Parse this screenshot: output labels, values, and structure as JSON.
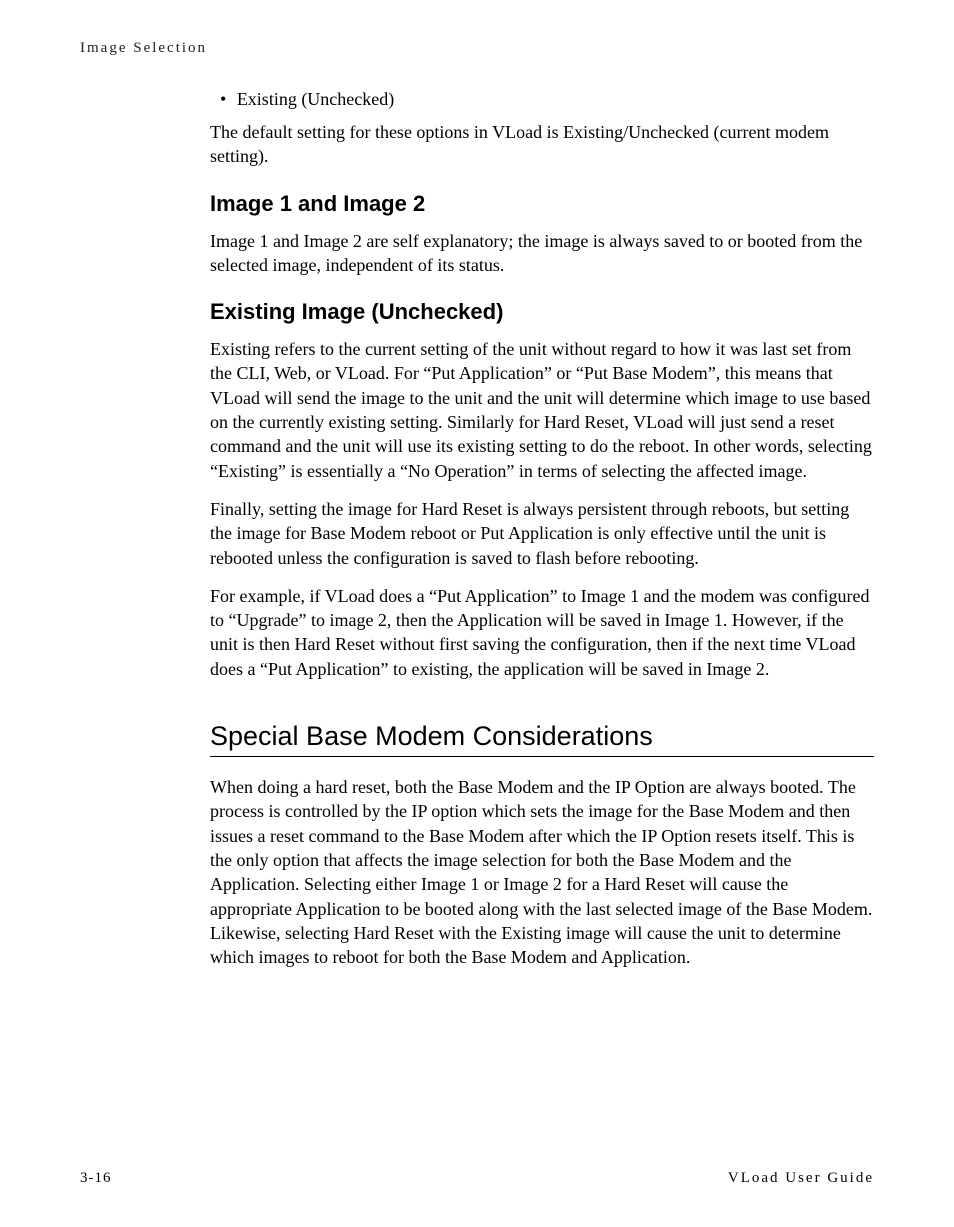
{
  "header": {
    "section": "Image Selection"
  },
  "bullet1": "Existing (Unchecked)",
  "p1": "The default setting for these options in VLoad is Existing/Unchecked (current modem setting).",
  "h2_1": "Image 1 and Image 2",
  "p2": "Image 1 and Image 2 are self explanatory; the image is always saved to or booted from the selected image, independent of its status.",
  "h2_2": "Existing Image (Unchecked)",
  "p3": "Existing refers to the current setting of the unit without regard to how it was last set from the CLI, Web, or VLoad. For “Put Application” or “Put Base Modem”, this means that VLoad will send the image to the unit and the unit will determine which image to use based on the currently existing setting. Similarly for Hard Reset, VLoad will just send a reset command and the unit will use its existing setting to do the reboot. In other words, selecting “Existing” is essentially a “No Operation” in terms of selecting the affected image.",
  "p4": "Finally, setting the image for Hard Reset is always persistent through reboots, but setting the image for Base Modem reboot or Put Application is only effective until the unit is rebooted unless the configuration is saved to flash before rebooting.",
  "p5": "For example, if VLoad does a “Put Application” to Image 1 and the modem was configured to “Upgrade” to image 2, then the Application will be saved in Image 1. However, if the unit is then Hard Reset without first saving the configuration, then if the next time VLoad does a “Put Application” to existing, the application will be saved in Image 2.",
  "h1_1": "Special Base Modem Considerations",
  "p6": "When doing a hard reset, both the Base Modem and the IP Option are always booted. The process is controlled by the IP option which sets the image for the Base Modem and then issues a reset command to the Base Modem after which the IP Option resets itself. This is the only option that affects the image selection for both the Base Modem and the Application. Selecting either Image 1 or Image 2 for a Hard Reset will cause the appropriate Application to be booted along with the last selected image of the Base Modem. Likewise, selecting Hard Reset with the Existing image will cause the unit to determine which images to reboot for both the Base Modem and Application.",
  "footer": {
    "page": "3-16",
    "doc": "VLoad User Guide"
  }
}
